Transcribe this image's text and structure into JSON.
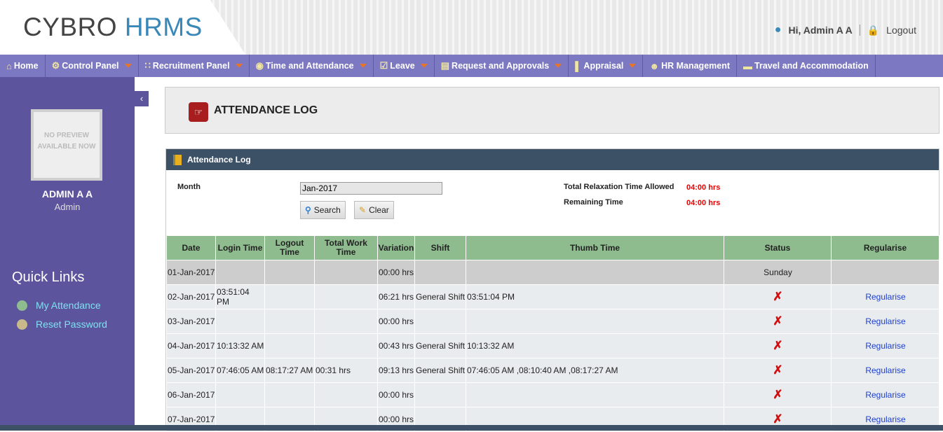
{
  "header": {
    "logo_a": "CYBRO",
    "logo_b": "HRMS",
    "greeting": "Hi, Admin A A",
    "logout": "Logout"
  },
  "nav": [
    {
      "label": "Home",
      "icon": "home-icon",
      "caret": false
    },
    {
      "label": "Control Panel",
      "icon": "gear-icon",
      "caret": true
    },
    {
      "label": "Recruitment Panel",
      "icon": "grid-icon",
      "caret": true
    },
    {
      "label": "Time and Attendance",
      "icon": "film-clock-icon",
      "caret": true
    },
    {
      "label": "Leave",
      "icon": "checkbox-icon",
      "caret": true
    },
    {
      "label": "Request and Approvals",
      "icon": "notepad-icon",
      "caret": true
    },
    {
      "label": "Appraisal",
      "icon": "bar-chart-icon",
      "caret": true
    },
    {
      "label": "HR Management",
      "icon": "person-icon",
      "caret": false
    },
    {
      "label": "Travel and Accommodation",
      "icon": "train-icon",
      "caret": false
    }
  ],
  "sidebar": {
    "photo_text": "NO PREVIEW AVAILABLE NOW",
    "name": "ADMIN A A",
    "role": "Admin",
    "quick_links_title": "Quick Links",
    "links": [
      {
        "label": "My Attendance",
        "color": "#8fbc8f"
      },
      {
        "label": "Reset Password",
        "color": "#c8b98a"
      }
    ]
  },
  "page": {
    "title": "ATTENDANCE LOG",
    "panel_title": "Attendance Log"
  },
  "form": {
    "month_label": "Month",
    "month_value": "Jan-2017",
    "search": "Search",
    "clear": "Clear",
    "relax_label": "Total Relaxation Time Allowed",
    "relax_value": "04:00 hrs",
    "remain_label": "Remaining Time",
    "remain_value": "04:00 hrs"
  },
  "table": {
    "headers": [
      "Date",
      "Login Time",
      "Logout Time",
      "Total Work Time",
      "Variation",
      "Shift",
      "Thumb Time",
      "Status",
      "Regularise"
    ],
    "rows": [
      {
        "date": "01-Jan-2017",
        "login": "",
        "logout": "",
        "total": "",
        "variation": "00:00 hrs",
        "shift": "",
        "thumb": "",
        "status": "Sunday",
        "reg": ""
      },
      {
        "date": "02-Jan-2017",
        "login": "03:51:04 PM",
        "logout": "",
        "total": "",
        "variation": "06:21 hrs",
        "shift": "General Shift",
        "thumb": "03:51:04 PM",
        "status": "x",
        "reg": "Regularise"
      },
      {
        "date": "03-Jan-2017",
        "login": "",
        "logout": "",
        "total": "",
        "variation": "00:00 hrs",
        "shift": "",
        "thumb": "",
        "status": "x",
        "reg": "Regularise"
      },
      {
        "date": "04-Jan-2017",
        "login": "10:13:32 AM",
        "logout": "",
        "total": "",
        "variation": "00:43 hrs",
        "shift": "General Shift",
        "thumb": "10:13:32 AM",
        "status": "x",
        "reg": "Regularise"
      },
      {
        "date": "05-Jan-2017",
        "login": "07:46:05 AM",
        "logout": "08:17:27 AM",
        "total": "00:31 hrs",
        "variation": "09:13 hrs",
        "shift": "General Shift",
        "thumb": "07:46:05 AM ,08:10:40 AM ,08:17:27 AM",
        "status": "x",
        "reg": "Regularise"
      },
      {
        "date": "06-Jan-2017",
        "login": "",
        "logout": "",
        "total": "",
        "variation": "00:00 hrs",
        "shift": "",
        "thumb": "",
        "status": "x",
        "reg": "Regularise"
      },
      {
        "date": "07-Jan-2017",
        "login": "",
        "logout": "",
        "total": "",
        "variation": "00:00 hrs",
        "shift": "",
        "thumb": "",
        "status": "x",
        "reg": "Regularise"
      }
    ]
  }
}
